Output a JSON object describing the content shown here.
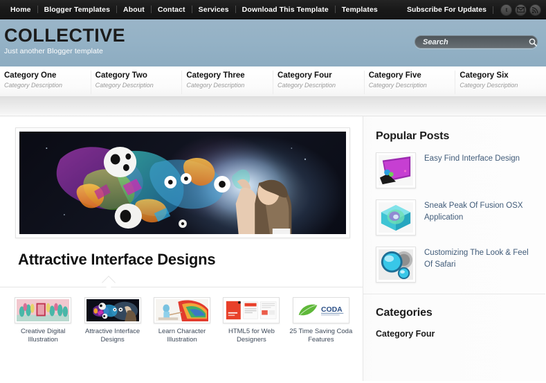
{
  "topbar": {
    "nav": [
      {
        "label": "Home"
      },
      {
        "label": "Blogger Templates"
      },
      {
        "label": "About"
      },
      {
        "label": "Contact"
      },
      {
        "label": "Services"
      },
      {
        "label": "Download This Template"
      },
      {
        "label": "Templates"
      }
    ],
    "subscribe_label": "Subscribe For Updates",
    "social": [
      {
        "name": "twitter-icon",
        "glyph": "t"
      },
      {
        "name": "email-icon",
        "glyph": "✉"
      },
      {
        "name": "rss-icon",
        "glyph": "≋"
      }
    ]
  },
  "header": {
    "logo": "COLLECTIVE",
    "tagline": "Just another Blogger template",
    "bg_color": "#93b1c5"
  },
  "search": {
    "placeholder": "Search",
    "value": ""
  },
  "categories_nav": [
    {
      "title": "Category One",
      "desc": "Category Description"
    },
    {
      "title": "Category Two",
      "desc": "Category Description"
    },
    {
      "title": "Category Three",
      "desc": "Category Description"
    },
    {
      "title": "Category Four",
      "desc": "Category Description"
    },
    {
      "title": "Category Five",
      "desc": "Category Description"
    },
    {
      "title": "Category Six",
      "desc": "Category Description"
    }
  ],
  "main": {
    "featured_post": {
      "image_alt": "abstract colorful artwork with woman and floating shapes",
      "title": "Attractive Interface Designs"
    },
    "thumbnails": [
      {
        "caption": "Creative Digital Illustration"
      },
      {
        "caption": "Attractive Interface Designs"
      },
      {
        "caption": "Learn Character Illustration"
      },
      {
        "caption": "HTML5 for Web Designers"
      },
      {
        "caption": "25 Time Saving Coda Features"
      }
    ]
  },
  "sidebar": {
    "popular_posts": {
      "heading": "Popular Posts",
      "items": [
        {
          "title": "Easy Find Interface Design"
        },
        {
          "title": "Sneak Peak Of Fusion OSX Application"
        },
        {
          "title": "Customizing The Look & Feel Of Safari"
        }
      ]
    },
    "categories": {
      "heading": "Categories",
      "items": [
        {
          "label": "Category Four"
        }
      ]
    }
  }
}
